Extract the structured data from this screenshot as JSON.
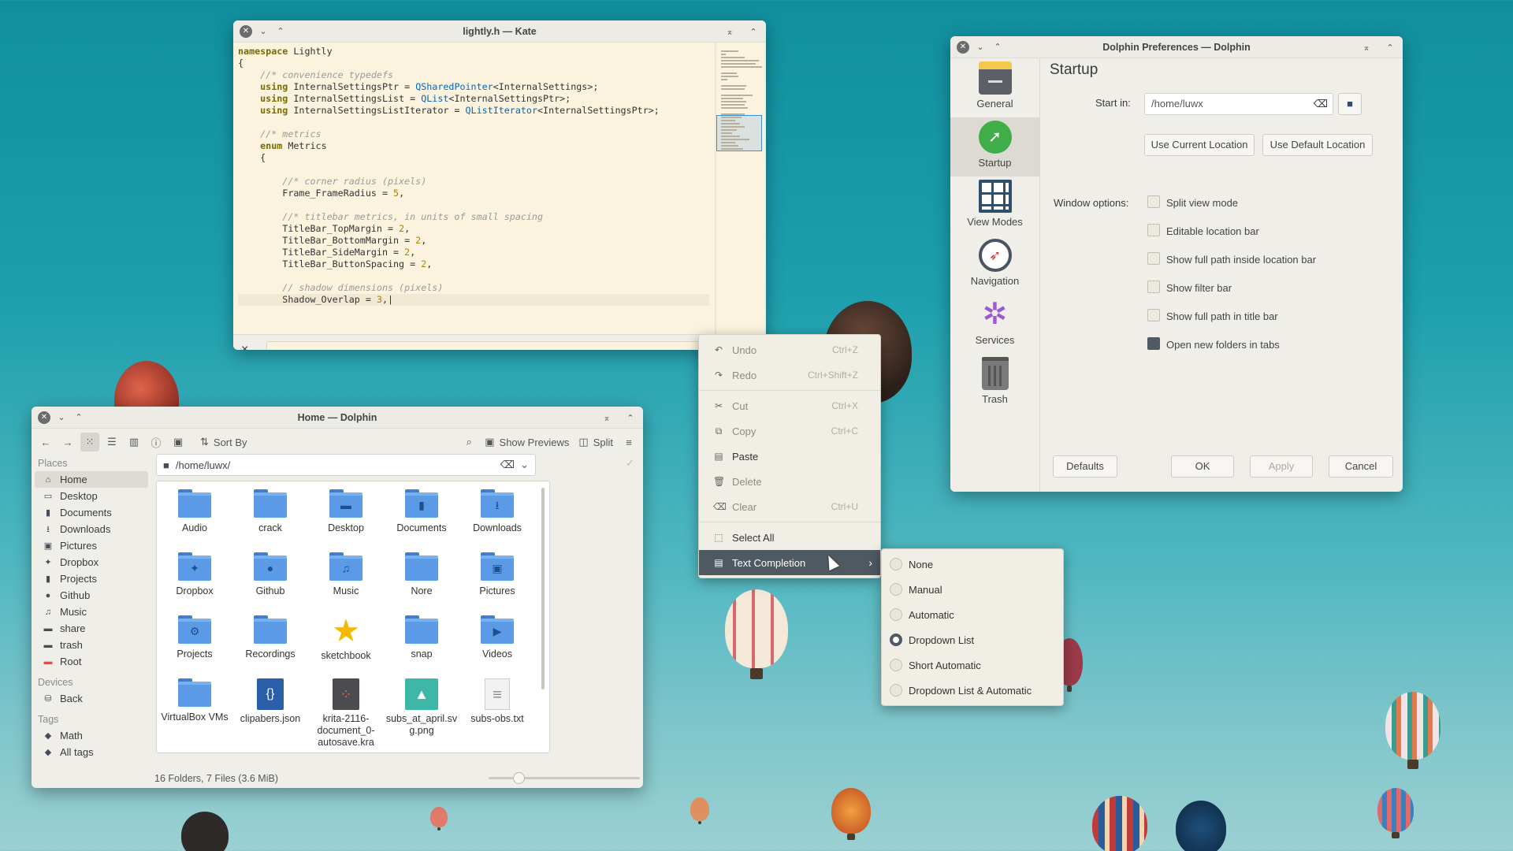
{
  "kate": {
    "title": "lightly.h — Kate",
    "code": [
      [
        {
          "t": "namespace ",
          "c": "kw"
        },
        {
          "t": "Lightly",
          "c": ""
        }
      ],
      [
        {
          "t": "{",
          "c": ""
        }
      ],
      [
        {
          "t": "    //* convenience typedefs",
          "c": "cm"
        }
      ],
      [
        {
          "t": "    using ",
          "c": "kw"
        },
        {
          "t": "InternalSettingsPtr = ",
          "c": ""
        },
        {
          "t": "QSharedPointer",
          "c": "ty"
        },
        {
          "t": "<InternalSettings>;",
          "c": ""
        }
      ],
      [
        {
          "t": "    using ",
          "c": "kw"
        },
        {
          "t": "InternalSettingsList = ",
          "c": ""
        },
        {
          "t": "QList",
          "c": "ty"
        },
        {
          "t": "<InternalSettingsPtr>;",
          "c": ""
        }
      ],
      [
        {
          "t": "    using ",
          "c": "kw"
        },
        {
          "t": "InternalSettingsListIterator = ",
          "c": ""
        },
        {
          "t": "QListIterator",
          "c": "ty"
        },
        {
          "t": "<InternalSettingsPtr>;",
          "c": ""
        }
      ],
      [
        {
          "t": "",
          "c": ""
        }
      ],
      [
        {
          "t": "    //* metrics",
          "c": "cm"
        }
      ],
      [
        {
          "t": "    enum ",
          "c": "kw"
        },
        {
          "t": "Metrics",
          "c": ""
        }
      ],
      [
        {
          "t": "    {",
          "c": ""
        }
      ],
      [
        {
          "t": "",
          "c": ""
        }
      ],
      [
        {
          "t": "        //* corner radius (pixels)",
          "c": "cm"
        }
      ],
      [
        {
          "t": "        Frame_FrameRadius = ",
          "c": ""
        },
        {
          "t": "5",
          "c": "nu"
        },
        {
          "t": ",",
          "c": ""
        }
      ],
      [
        {
          "t": "",
          "c": ""
        }
      ],
      [
        {
          "t": "        //* titlebar metrics, in units of small spacing",
          "c": "cm"
        }
      ],
      [
        {
          "t": "        TitleBar_TopMargin = ",
          "c": ""
        },
        {
          "t": "2",
          "c": "nu"
        },
        {
          "t": ",",
          "c": ""
        }
      ],
      [
        {
          "t": "        TitleBar_BottomMargin = ",
          "c": ""
        },
        {
          "t": "2",
          "c": "nu"
        },
        {
          "t": ",",
          "c": ""
        }
      ],
      [
        {
          "t": "        TitleBar_SideMargin = ",
          "c": ""
        },
        {
          "t": "2",
          "c": "nu"
        },
        {
          "t": ",",
          "c": ""
        }
      ],
      [
        {
          "t": "        TitleBar_ButtonSpacing = ",
          "c": ""
        },
        {
          "t": "2",
          "c": "nu"
        },
        {
          "t": ",",
          "c": ""
        }
      ],
      [
        {
          "t": "",
          "c": ""
        }
      ],
      [
        {
          "t": "        // shadow dimensions (pixels)",
          "c": "cm"
        }
      ],
      [
        {
          "t": "        Shadow_Overlap = ",
          "c": ""
        },
        {
          "t": "3",
          "c": "nu"
        },
        {
          "t": ",|",
          "c": ""
        }
      ]
    ],
    "close_label": "×",
    "help_label": "?"
  },
  "context_menu": {
    "items": [
      {
        "label": "Undo",
        "shortcut": "Ctrl+Z",
        "icon": "undo-icon",
        "glyph": "↶",
        "disabled": true
      },
      {
        "label": "Redo",
        "shortcut": "Ctrl+Shift+Z",
        "icon": "redo-icon",
        "glyph": "↷",
        "disabled": true
      },
      {
        "sep": true
      },
      {
        "label": "Cut",
        "shortcut": "Ctrl+X",
        "icon": "cut-icon",
        "glyph": "✂",
        "disabled": true
      },
      {
        "label": "Copy",
        "shortcut": "Ctrl+C",
        "icon": "copy-icon",
        "glyph": "⧉",
        "disabled": true
      },
      {
        "label": "Paste",
        "shortcut": "",
        "icon": "paste-icon",
        "glyph": "▤",
        "disabled": false
      },
      {
        "label": "Delete",
        "shortcut": "",
        "icon": "delete-icon",
        "glyph": "🗑",
        "disabled": true
      },
      {
        "label": "Clear",
        "shortcut": "Ctrl+U",
        "icon": "clear-icon",
        "glyph": "⌫",
        "disabled": true
      },
      {
        "sep": true
      },
      {
        "label": "Select All",
        "shortcut": "",
        "icon": "select-all-icon",
        "glyph": "⬚",
        "disabled": false
      },
      {
        "label": "Text Completion",
        "shortcut": "",
        "icon": "text-completion-icon",
        "glyph": "▤",
        "disabled": false,
        "highlighted": true,
        "submenu": true
      }
    ]
  },
  "completion_menu": {
    "items": [
      {
        "label": "None",
        "checked": false
      },
      {
        "label": "Manual",
        "checked": false
      },
      {
        "label": "Automatic",
        "checked": false
      },
      {
        "label": "Dropdown List",
        "checked": true
      },
      {
        "label": "Short Automatic",
        "checked": false
      },
      {
        "label": "Dropdown List & Automatic",
        "checked": false
      }
    ]
  },
  "dolphin": {
    "title": "Home — Dolphin",
    "toolbar": {
      "sort_by": "Sort By",
      "show_previews": "Show Previews",
      "split": "Split"
    },
    "places_heading": "Places",
    "places": [
      {
        "label": "Home",
        "icon": "home-icon",
        "glyph": "⌂",
        "selected": true
      },
      {
        "label": "Desktop",
        "icon": "desktop-icon",
        "glyph": "▭"
      },
      {
        "label": "Documents",
        "icon": "documents-icon",
        "glyph": "▮"
      },
      {
        "label": "Downloads",
        "icon": "downloads-icon",
        "glyph": "⭳"
      },
      {
        "label": "Pictures",
        "icon": "pictures-icon",
        "glyph": "▣"
      },
      {
        "label": "Dropbox",
        "icon": "dropbox-icon",
        "glyph": "✦"
      },
      {
        "label": "Projects",
        "icon": "projects-icon",
        "glyph": "▮"
      },
      {
        "label": "Github",
        "icon": "github-icon",
        "glyph": "●"
      },
      {
        "label": "Music",
        "icon": "music-icon",
        "glyph": "♫"
      },
      {
        "label": "share",
        "icon": "share-icon",
        "glyph": "▬"
      },
      {
        "label": "trash",
        "icon": "trash-icon",
        "glyph": "▬"
      },
      {
        "label": "Root",
        "icon": "root-icon",
        "glyph": "▬",
        "color": "#d9534f"
      }
    ],
    "devices_heading": "Devices",
    "devices": [
      {
        "label": "Back",
        "icon": "drive-icon",
        "glyph": "⛁"
      }
    ],
    "tags_heading": "Tags",
    "tags": [
      {
        "label": "Math",
        "icon": "tag-icon",
        "glyph": "◆"
      },
      {
        "label": "All tags",
        "icon": "tags-icon",
        "glyph": "◆"
      }
    ],
    "path": "/home/luwx/",
    "files": [
      {
        "name": "Audio",
        "kind": "folder",
        "glyph": ""
      },
      {
        "name": "crack",
        "kind": "folder",
        "glyph": ""
      },
      {
        "name": "Desktop",
        "kind": "folder",
        "glyph": "▬"
      },
      {
        "name": "Documents",
        "kind": "folder",
        "glyph": "▮"
      },
      {
        "name": "Downloads",
        "kind": "folder",
        "glyph": "⭳"
      },
      {
        "name": "Dropbox",
        "kind": "folder",
        "glyph": "✦"
      },
      {
        "name": "Github",
        "kind": "folder",
        "glyph": "●"
      },
      {
        "name": "Music",
        "kind": "folder",
        "glyph": "♫"
      },
      {
        "name": "Nore",
        "kind": "folder",
        "glyph": ""
      },
      {
        "name": "Pictures",
        "kind": "folder",
        "glyph": "▣"
      },
      {
        "name": "Projects",
        "kind": "folder",
        "glyph": "⚙"
      },
      {
        "name": "Recordings",
        "kind": "folder",
        "glyph": ""
      },
      {
        "name": "sketchbook",
        "kind": "star",
        "glyph": "★"
      },
      {
        "name": "snap",
        "kind": "folder",
        "glyph": ""
      },
      {
        "name": "Videos",
        "kind": "folder",
        "glyph": "▶"
      },
      {
        "name": "VirtualBox VMs",
        "kind": "folder",
        "glyph": ""
      },
      {
        "name": "clipabers.json",
        "kind": "json",
        "glyph": "{}"
      },
      {
        "name": "krita-2116-document_0-autosave.kra",
        "kind": "kra",
        "glyph": "⁘"
      },
      {
        "name": "subs_at_april.svg.png",
        "kind": "image",
        "glyph": "▲"
      },
      {
        "name": "subs-obs.txt",
        "kind": "text",
        "glyph": "≡"
      }
    ],
    "status": "16 Folders, 7 Files (3.6 MiB)",
    "zoom_fraction": 0.2
  },
  "prefs": {
    "title": "Dolphin Preferences — Dolphin",
    "categories": [
      {
        "label": "General",
        "icon": "general-icon",
        "selected": false
      },
      {
        "label": "Startup",
        "icon": "startup-icon",
        "selected": true
      },
      {
        "label": "View Modes",
        "icon": "view-modes-icon",
        "selected": false
      },
      {
        "label": "Navigation",
        "icon": "navigation-icon",
        "selected": false
      },
      {
        "label": "Services",
        "icon": "services-icon",
        "selected": false
      },
      {
        "label": "Trash",
        "icon": "trash-bin-icon",
        "selected": false
      }
    ],
    "heading": "Startup",
    "start_in_label": "Start in:",
    "start_in_value": "/home/luwx",
    "use_current": "Use Current Location",
    "use_default": "Use Default Location",
    "window_options_label": "Window options:",
    "options": [
      {
        "label": "Split view mode",
        "checked": false
      },
      {
        "label": "Editable location bar",
        "checked": false
      },
      {
        "label": "Show full path inside location bar",
        "checked": false
      },
      {
        "label": "Show filter bar",
        "checked": false
      },
      {
        "label": "Show full path in title bar",
        "checked": false
      },
      {
        "label": "Open new folders in tabs",
        "checked": true
      }
    ],
    "defaults": "Defaults",
    "ok": "OK",
    "apply": "Apply",
    "cancel": "Cancel"
  }
}
